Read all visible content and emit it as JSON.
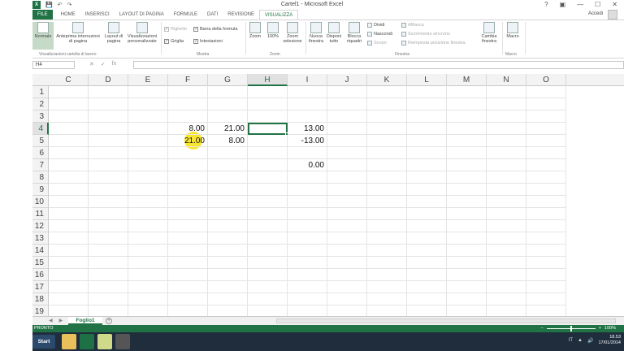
{
  "window": {
    "title": "Cartel1 - Microsoft Excel",
    "help": "?",
    "controls": [
      "▣",
      "—",
      "☐",
      "✕"
    ]
  },
  "tabs": [
    "FILE",
    "HOME",
    "INSERISCI",
    "LAYOUT DI PAGINA",
    "FORMULE",
    "DATI",
    "REVISIONE",
    "VISUALIZZA"
  ],
  "account_label": "Accedi",
  "ribbon": {
    "views": [
      {
        "label": "Normale"
      },
      {
        "label": "Anteprima interruzioni di pagina"
      },
      {
        "label": "Layout di pagina"
      },
      {
        "label": "Visualizzazioni personalizzate"
      }
    ],
    "views_group_label": "Visualizzazioni cartella di lavoro",
    "show": {
      "righello": "Righello",
      "barra_formula": "Barra della formula",
      "griglia": "Griglia",
      "intestazioni": "Intestazioni",
      "group_label": "Mostra"
    },
    "zoom": {
      "zoom_label": "Zoom",
      "hundred_label": "100%",
      "selection_label": "Zoom selezione",
      "group_label": "Zoom"
    },
    "window": {
      "nuova": "Nuova finestra",
      "disponi": "Disponi tutto",
      "blocca": "Blocca riquadri",
      "dividi": "Dividi",
      "nascondi": "Nascondi",
      "scopri": "Scopri",
      "affianca": "Affianca",
      "scorrimento": "Scorrimento sincrono",
      "reimposta": "Reimposta posizione finestra",
      "cambia": "Cambia finestra",
      "group_label": "Finestra"
    },
    "macro": {
      "label": "Macro",
      "group_label": "Macro"
    }
  },
  "formula_bar": {
    "name_box": "H4",
    "icons": [
      "✕",
      "✓",
      "fx"
    ],
    "value": ""
  },
  "columns": [
    "C",
    "D",
    "E",
    "F",
    "G",
    "H",
    "I",
    "J",
    "K",
    "L",
    "M",
    "N",
    "O"
  ],
  "active_column": "H",
  "rows": [
    "1",
    "2",
    "3",
    "4",
    "5",
    "6",
    "7",
    "8",
    "9",
    "10",
    "11",
    "12",
    "13",
    "14",
    "15",
    "16",
    "17",
    "18",
    "19"
  ],
  "active_row": "4",
  "cells": {
    "F4": "8.00",
    "G4": "21.00",
    "I4": "13.00",
    "F5": "21.00",
    "G5": "8.00",
    "I5": "-13.00",
    "I7": "0.00"
  },
  "sheets": [
    "Foglio1"
  ],
  "add_sheet_label": "+",
  "status": {
    "mode": "PRONTO",
    "zoom": "100%",
    "zoom_level_percent": 100
  },
  "taskbar": {
    "start_label": "Start",
    "lang": "IT",
    "time": "18.53",
    "date": "17/01/2014"
  }
}
